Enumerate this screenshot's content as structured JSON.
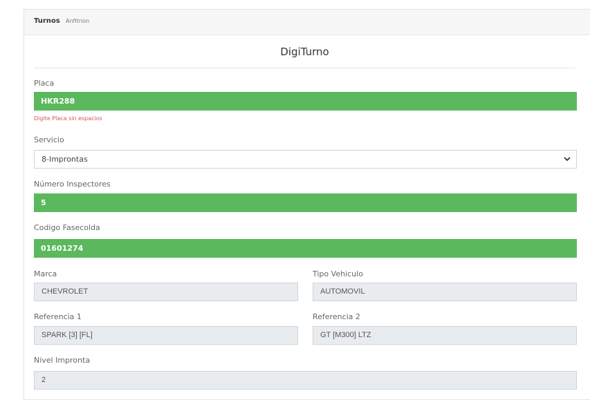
{
  "header": {
    "title": "Turnos",
    "subtitle": "Anfitrion"
  },
  "form": {
    "title": "DigiTurno",
    "placa": {
      "label": "Placa",
      "value": "HKR288",
      "help": "Digite Placa sin espacios"
    },
    "servicio": {
      "label": "Servicio",
      "value": "8-Improntas"
    },
    "inspectores": {
      "label": "Número Inspectores",
      "value": "5"
    },
    "fasecolda": {
      "label": "Codigo Fasecolda",
      "value": "01601274"
    },
    "marca": {
      "label": "Marca",
      "value": "CHEVROLET"
    },
    "tipo_vehiculo": {
      "label": "Tipo Vehiculo",
      "value": "AUTOMOVIL"
    },
    "referencia1": {
      "label": "Referencia 1",
      "value": "SPARK [3] [FL]"
    },
    "referencia2": {
      "label": "Referencia 2",
      "value": "GT [M300] LTZ"
    },
    "nivel_impronta": {
      "label": "Nivel Impronta",
      "value": "2"
    }
  },
  "colors": {
    "valid_field": "#5cb85c",
    "help_text": "#d9534f",
    "readonly_field": "#e9ecef"
  },
  "icons": {
    "select_arrow": "chevron-down-icon"
  }
}
